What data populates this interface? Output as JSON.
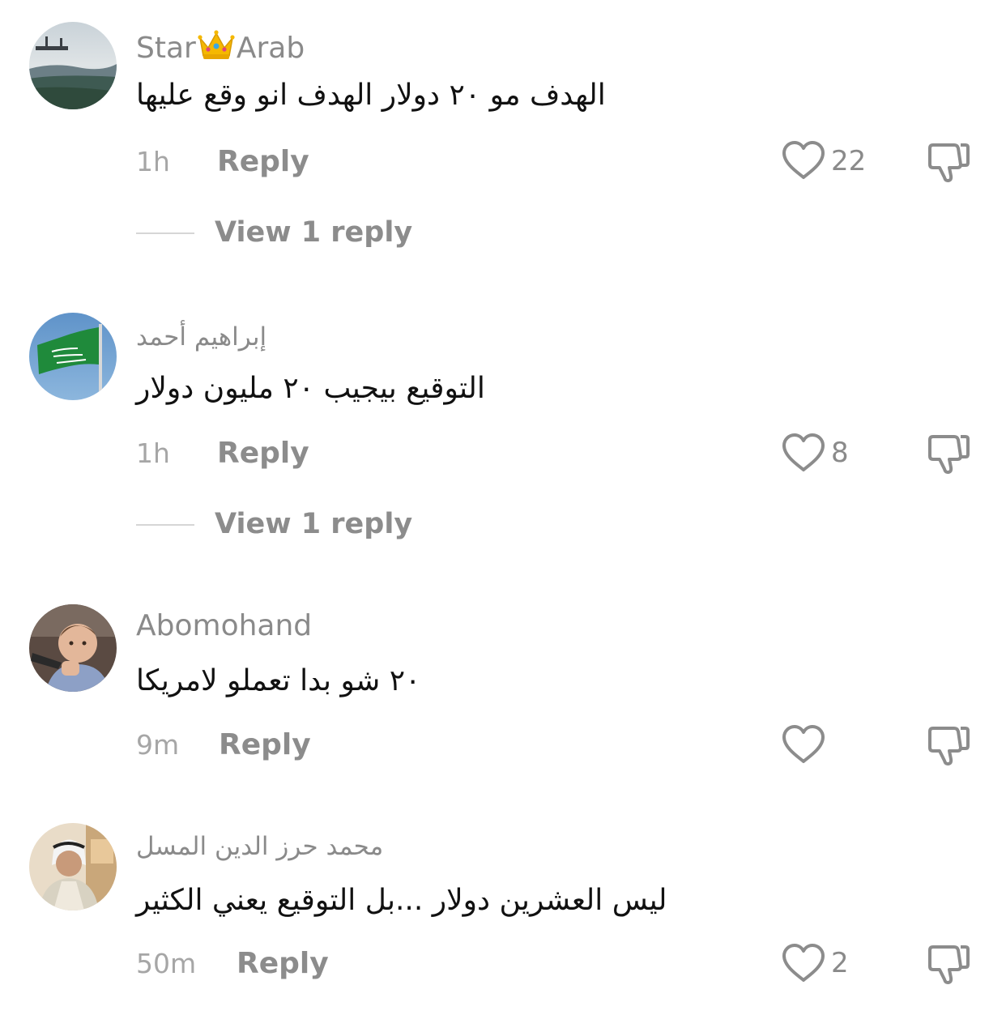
{
  "comments": [
    {
      "username_parts": [
        "Star",
        "Arab"
      ],
      "username_emoji": "crown",
      "text": "الهدف مو ٢٠ دولار الهدف انو وقع عليها",
      "time": "1h",
      "reply_label": "Reply",
      "likes": "22",
      "view_replies": "View 1 reply"
    },
    {
      "username": "إبراهيم أحمد",
      "text": "التوقيع بيجيب ٢٠ مليون دولار",
      "time": "1h",
      "reply_label": "Reply",
      "likes": "8",
      "view_replies": "View 1 reply"
    },
    {
      "username": "Abomohand",
      "text": "٢٠ شو بدا تعملو لامريكا",
      "time": "9m",
      "reply_label": "Reply",
      "likes": ""
    },
    {
      "username": "محمد حرز الدين المسل",
      "text": "ليس العشرين دولار ...بل التوقيع يعني الكثير",
      "time": "50m",
      "reply_label": "Reply",
      "likes": "2"
    }
  ],
  "icons": {
    "like": "heart-outline-icon",
    "dislike": "thumbs-down-icon"
  },
  "colors": {
    "muted": "#8a8a8a",
    "text": "#111111",
    "icon": "#8c8c8c"
  }
}
